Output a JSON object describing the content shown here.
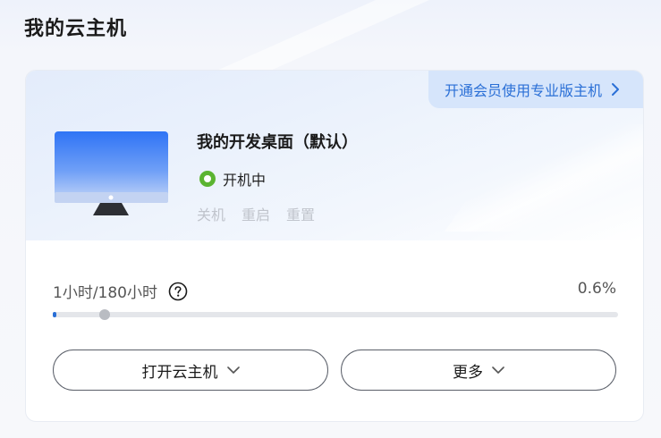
{
  "page": {
    "title": "我的云主机"
  },
  "card": {
    "promo_text": "开通会员使用专业版主机",
    "vm_name": "我的开发桌面（默认）",
    "status_text": "开机中",
    "status_color": "#5bb431",
    "actions": [
      "关机",
      "重启",
      "重置"
    ],
    "usage": {
      "label": "1小时/180小时",
      "percent_text": "0.6%",
      "progress_fraction": 0.006
    },
    "buttons": {
      "open_label": "打开云主机",
      "more_label": "更多"
    }
  },
  "colors": {
    "accent": "#2a6fd6",
    "promo_bg": "#d6e5fb",
    "disabled_text": "#c0c4cc"
  },
  "icons": {
    "promo_chevron": "chevron-right-icon",
    "help": "question-circle-icon",
    "dropdown": "chevron-down-icon",
    "vm": "monitor-icon"
  }
}
